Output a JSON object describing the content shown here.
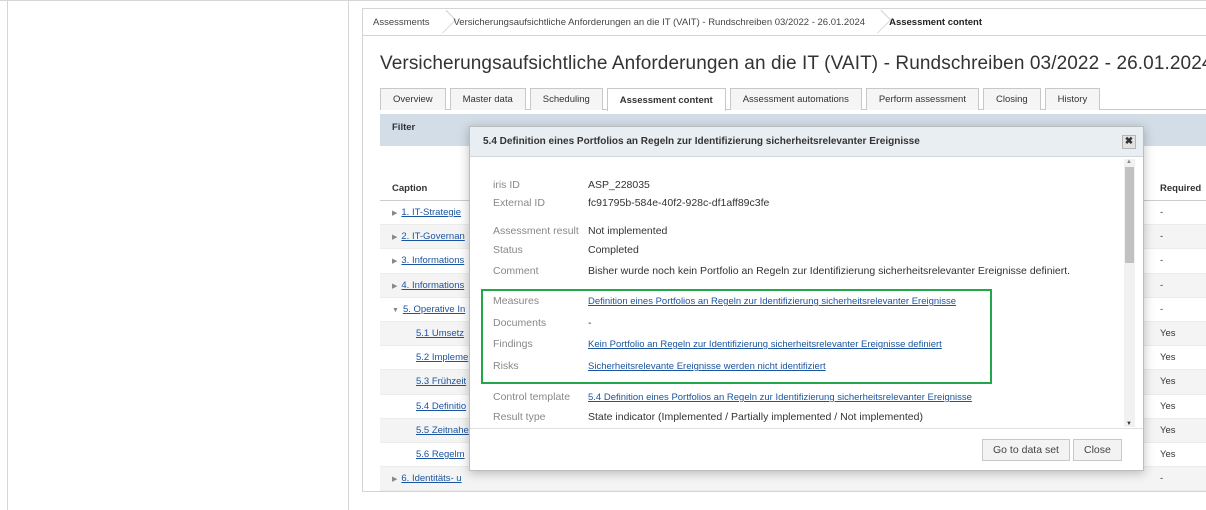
{
  "breadcrumb": {
    "items": [
      "Assessments",
      "Versicherungsaufsichtliche Anforderungen an die IT (VAIT) - Rundschreiben 03/2022 - 26.01.2024",
      "Assessment content"
    ]
  },
  "page_title": "Versicherungsaufsichtliche Anforderungen an die IT (VAIT) - Rundschreiben 03/2022 - 26.01.2024",
  "tabs": [
    "Overview",
    "Master data",
    "Scheduling",
    "Assessment content",
    "Assessment automations",
    "Perform assessment",
    "Closing",
    "History"
  ],
  "active_tab": "Assessment content",
  "filter": {
    "label": "Filter"
  },
  "table": {
    "headers": {
      "caption": "Caption",
      "required": "Required"
    },
    "rows": [
      {
        "caption": "1. IT-Strategie",
        "required": "-",
        "level": 0
      },
      {
        "caption": "2. IT-Governan",
        "required": "-",
        "level": 0
      },
      {
        "caption": "3. Informations",
        "required": "-",
        "level": 0
      },
      {
        "caption": "4. Informations",
        "required": "-",
        "level": 0
      },
      {
        "caption": "5. Operative In",
        "required": "-",
        "level": 0,
        "expanded": true
      },
      {
        "caption": "5.1 Umsetz",
        "required": "Yes",
        "level": 1
      },
      {
        "caption": "5.2 Impleme",
        "required": "Yes",
        "level": 1
      },
      {
        "caption": "5.3 Frühzeit",
        "required": "Yes",
        "level": 1
      },
      {
        "caption": "5.4 Definitio",
        "required": "Yes",
        "level": 1
      },
      {
        "caption": "5.5 Zeitnahe",
        "required": "Yes",
        "level": 1
      },
      {
        "caption": "5.6 Regelm",
        "required": "Yes",
        "level": 1
      },
      {
        "caption": "6. Identitäts- u",
        "required": "-",
        "level": 0
      }
    ]
  },
  "modal": {
    "title": "5.4 Definition eines Portfolios an Regeln zur Identifizierung sicherheitsrelevanter Ereignisse",
    "close_icon": "✖",
    "fields": {
      "iris_id": {
        "label": "iris ID",
        "value": "ASP_228035"
      },
      "external_id": {
        "label": "External ID",
        "value": "fc91795b-584e-40f2-928c-df1aff89c3fe"
      },
      "assessment_result": {
        "label": "Assessment result",
        "value": "Not implemented"
      },
      "status": {
        "label": "Status",
        "value": "Completed"
      },
      "comment": {
        "label": "Comment",
        "value": "Bisher wurde noch kein Portfolio an Regeln zur Identifizierung sicherheitsrelevanter Ereignisse definiert."
      },
      "measures": {
        "label": "Measures",
        "value": "Definition eines Portfolios an Regeln zur Identifizierung sicherheitsrelevanter Ereignisse"
      },
      "documents": {
        "label": "Documents",
        "value": "-"
      },
      "findings": {
        "label": "Findings",
        "value": "Kein Portfolio an Regeln zur Identifizierung sicherheitsrelevanter Ereignisse definiert"
      },
      "risks": {
        "label": "Risks",
        "value": "Sicherheitsrelevante Ereignisse werden nicht identifiziert"
      },
      "control_template": {
        "label": "Control template",
        "value": "5.4 Definition eines Portfolios an Regeln zur Identifizierung sicherheitsrelevanter Ereignisse"
      },
      "result_type": {
        "label": "Result type",
        "value": "State indicator (Implemented / Partially implemented / Not implemented)"
      }
    },
    "buttons": {
      "go_to_data_set": "Go to data set",
      "close": "Close"
    }
  },
  "colors": {
    "link": "#1b55a0",
    "highlight": "#22a84a",
    "filter_bar": "#d2dde7"
  },
  "icons": {
    "close": "close-icon",
    "expand": "triangle-right-icon",
    "collapse": "triangle-down-icon"
  }
}
